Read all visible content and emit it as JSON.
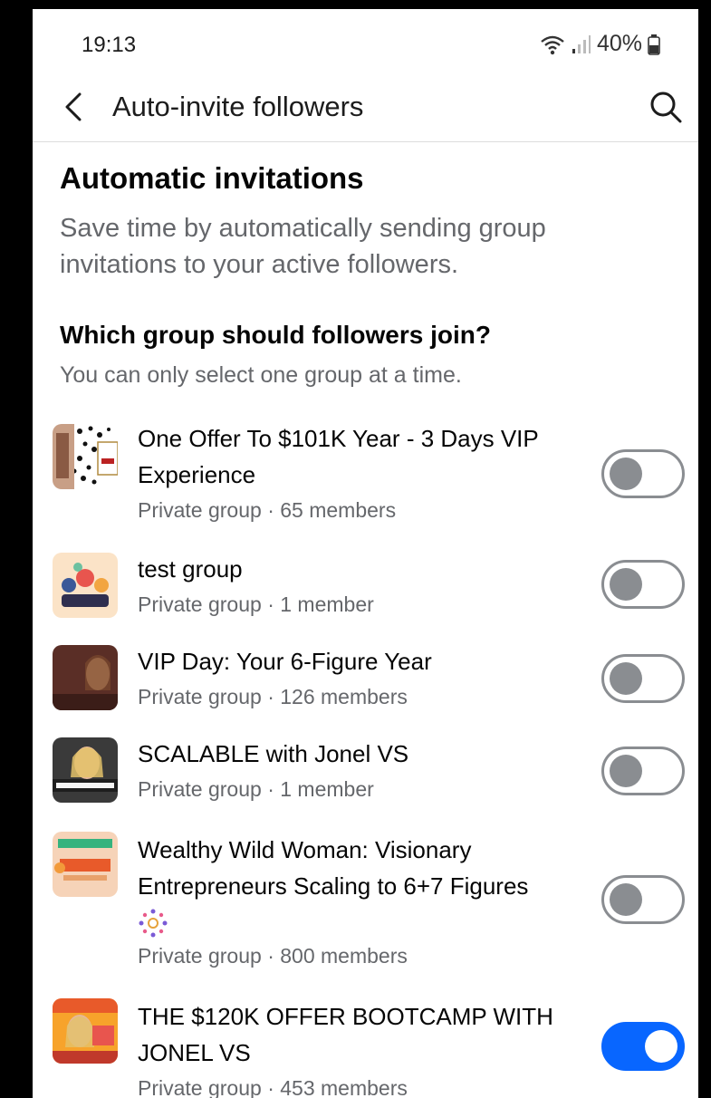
{
  "status_bar": {
    "time": "19:13",
    "battery": "40%"
  },
  "app_bar": {
    "title": "Auto-invite followers"
  },
  "intro": {
    "heading": "Automatic invitations",
    "text": "Save time by automatically sending group invitations to your active followers."
  },
  "question": {
    "heading": "Which group should followers join?",
    "subtext": "You can only select one group at a time."
  },
  "groups": [
    {
      "name": "One Offer To $101K Year - 3 Days VIP Experience",
      "meta": "Private group · 65 members",
      "enabled": false
    },
    {
      "name": "test group",
      "meta": "Private group · 1 member",
      "enabled": false
    },
    {
      "name": "VIP Day: Your 6-Figure Year",
      "meta": "Private group · 126 members",
      "enabled": false
    },
    {
      "name": "SCALABLE with Jonel VS",
      "meta": "Private group · 1 member",
      "enabled": false
    },
    {
      "name": "Wealthy Wild Woman: Visionary Entrepreneurs Scaling to 6+7 Figures",
      "meta": "Private group · 800 members",
      "enabled": false
    },
    {
      "name": "THE $120K OFFER BOOTCAMP WITH JONEL VS",
      "meta": "Private group · 453 members",
      "enabled": true
    }
  ],
  "icons": {
    "back": "chevron-left-icon",
    "search": "search-icon",
    "wifi": "wifi-icon",
    "signal": "signal-icon",
    "battery": "battery-icon"
  },
  "colors": {
    "toggle_on": "#0866ff",
    "toggle_off": "#8a8d91",
    "secondary_text": "#65676b"
  }
}
